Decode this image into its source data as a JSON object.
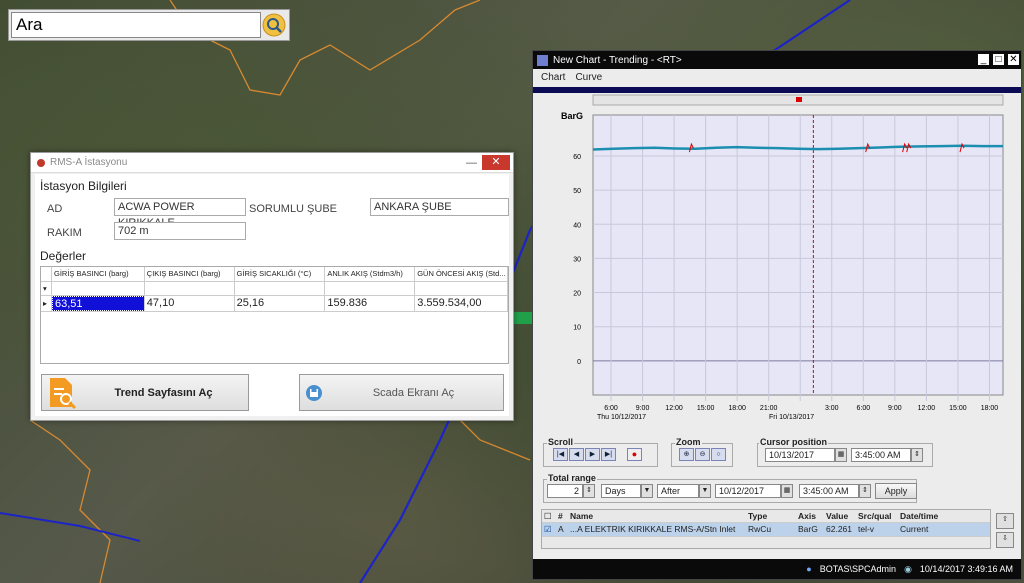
{
  "search": {
    "value": "Ara"
  },
  "station": {
    "window_title": "RMS-A İstasyonu",
    "info_title": "İstasyon Bilgileri",
    "ad_label": "AD",
    "ad_value": "ACWA POWER KIRIKKALE",
    "sube_label": "SORUMLU ŞUBE",
    "sube_value": "ANKARA ŞUBE",
    "rakim_label": "RAKIM",
    "rakim_value": "702 m",
    "values_title": "Değerler",
    "columns": [
      "GİRİŞ BASINCI (barg)",
      "ÇIKIŞ BASINCI (barg)",
      "GİRİŞ SICAKLIĞI (°C)",
      "ANLIK AKIŞ (Stdm3/h)",
      "GÜN ÖNCESİ AKIŞ (Std..."
    ],
    "row": [
      "63,51",
      "47,10",
      "25,16",
      "159.836",
      "3.559.534,00"
    ],
    "trend_button": "Trend Sayfasını Aç",
    "scada_button": "Scada Ekranı Aç"
  },
  "trend": {
    "window_title": "New Chart - Trending - <RT>",
    "menu": [
      "Chart",
      "Curve"
    ],
    "y_unit": "BarG",
    "y_ticks": [
      "60",
      "50",
      "40",
      "30",
      "20",
      "10",
      "0"
    ],
    "x_ticks": [
      "6:00",
      "9:00",
      "12:00",
      "15:00",
      "18:00",
      "21:00",
      "3:00",
      "6:00",
      "9:00",
      "12:00",
      "15:00",
      "18:00",
      "21:00"
    ],
    "day_labels": [
      "Thu 10/12/2017",
      "Fri 10/13/2017"
    ],
    "scroll_label": "Scroll",
    "zoom_label": "Zoom",
    "cursor_label": "Cursor position",
    "cursor_date": "10/13/2017",
    "cursor_time": "3:45:00 AM",
    "total_range_label": "Total range",
    "range_value": "2",
    "range_unit": "Days",
    "range_mode": "After",
    "range_date": "10/12/2017",
    "range_time": "3:45:00 AM",
    "apply_label": "Apply",
    "table_headers": [
      "#",
      "Name",
      "Type",
      "Axis",
      "Value",
      "Src/qual",
      "Date/time"
    ],
    "table_row": [
      "A",
      "...A ELEKTRIK KIRIKKALE RMS-A/Stn Inlet",
      "RwCu",
      "BarG",
      "62.261",
      "tel-v",
      "Current"
    ],
    "status_user": "BOTAS\\SPCAdmin",
    "status_time": "10/14/2017 3:49:16 AM"
  },
  "chart_data": {
    "type": "line",
    "title": "",
    "xlabel": "",
    "ylabel": "BarG",
    "ylim": [
      -10,
      72
    ],
    "x_ticks": [
      "6:00",
      "9:00",
      "12:00",
      "15:00",
      "18:00",
      "21:00",
      "3:00",
      "6:00",
      "9:00",
      "12:00",
      "15:00",
      "18:00",
      "21:00"
    ],
    "x_hours": [
      0,
      6,
      12,
      18,
      24,
      30,
      36,
      42,
      48,
      54,
      60,
      66,
      72,
      78,
      84,
      90,
      96,
      102,
      108,
      114,
      120
    ],
    "series": [
      {
        "values": [
          61.9,
          62.1,
          62.3,
          62.4,
          62.2,
          62.1,
          62.4,
          62.6,
          62.4,
          62.3,
          62.1,
          62.0,
          62.1,
          62.3,
          62.5,
          62.7,
          62.8,
          62.9,
          63.0,
          62.9,
          62.9
        ]
      }
    ],
    "cursor": "10/13/2017 3:45:00 AM",
    "grid": true
  }
}
